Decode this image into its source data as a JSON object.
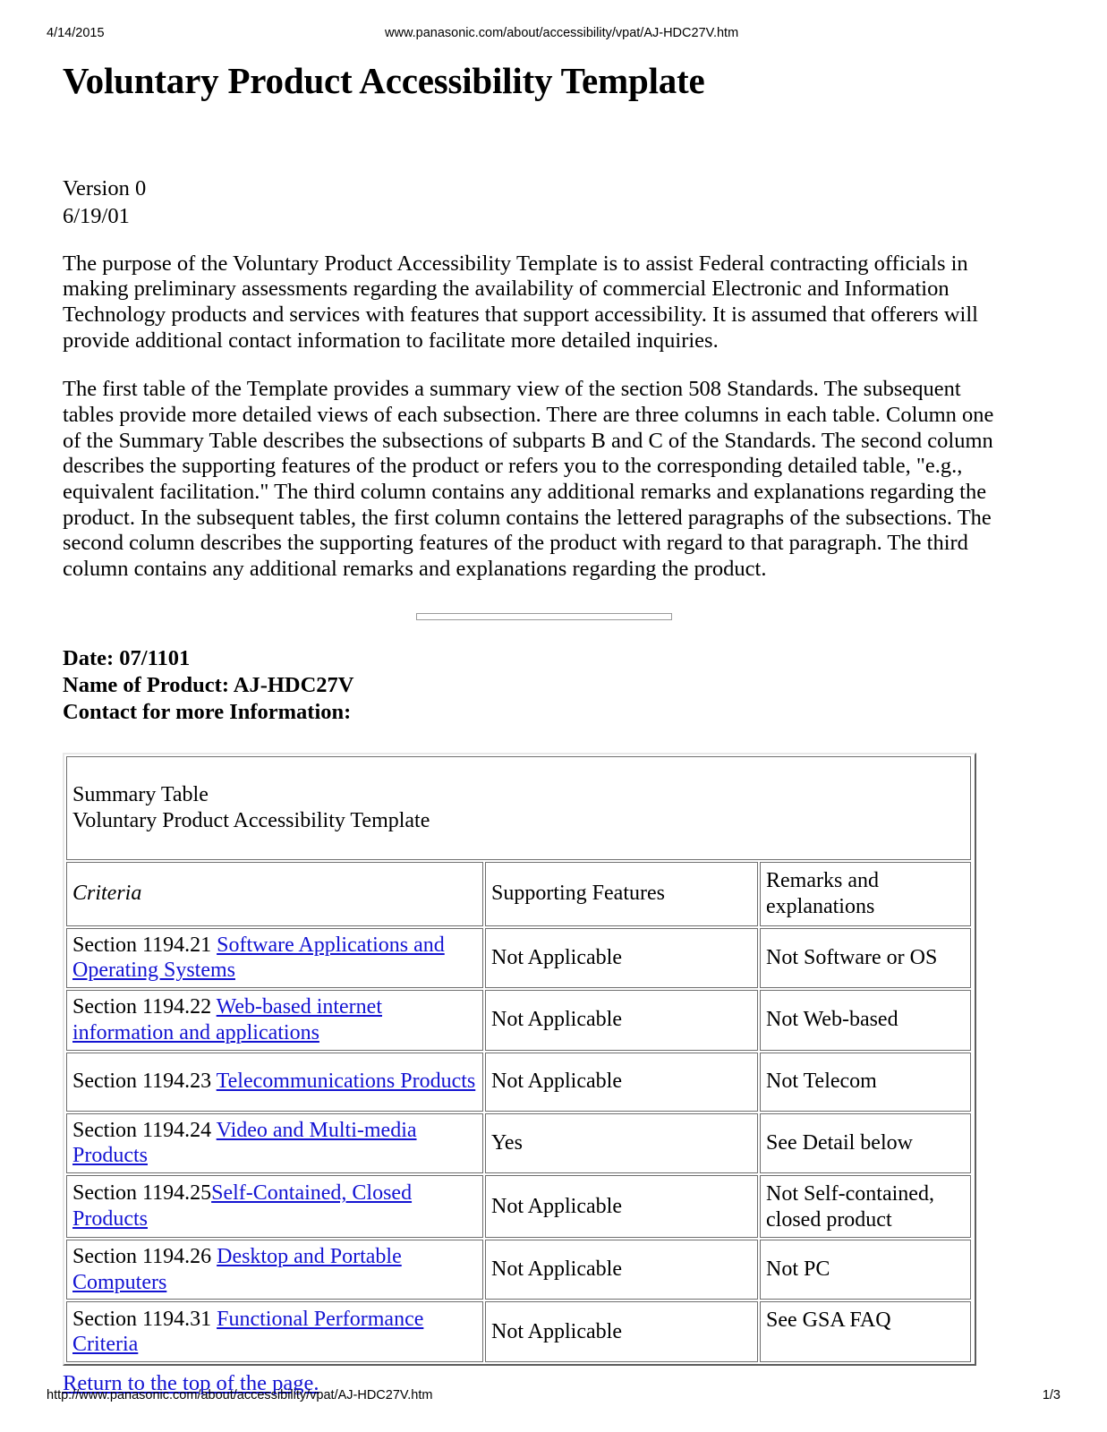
{
  "print_header": {
    "date": "4/14/2015",
    "url": "www.panasonic.com/about/accessibility/vpat/AJ-HDC27V.htm"
  },
  "document": {
    "title": "Voluntary Product Accessibility Template",
    "version_label": "Version 0",
    "version_date": "6/19/01",
    "paragraph_1": "The purpose of the Voluntary Product Accessibility Template is to assist Federal contracting officials in making preliminary assessments regarding the availability of commercial Electronic and Information Technology products and services with features that support accessibility. It is assumed that offerers will provide additional contact information to facilitate more detailed inquiries.",
    "paragraph_2": "The first table of the Template provides a summary view of the section 508 Standards. The subsequent tables provide more detailed views of each subsection. There are three columns in each table. Column one of the Summary Table describes the subsections of subparts B and C of the Standards. The second column describes the supporting features of the product or refers you to the corresponding detailed table, \"e.g., equivalent facilitation.\" The third column contains any additional remarks and explanations regarding the product. In the subsequent tables, the first column contains the lettered paragraphs of the subsections. The second column describes the supporting features of the product with regard to that paragraph. The third column contains any additional remarks and explanations regarding the product.",
    "meta": {
      "date_line": "Date: 07/1101",
      "product_line": "Name of Product: AJ-HDC27V",
      "contact_line": "Contact for more Information:"
    }
  },
  "summary_table": {
    "caption_line_1": "Summary Table",
    "caption_line_2": "Voluntary Product Accessibility Template",
    "headers": {
      "criteria": "Criteria",
      "supporting_features": "Supporting Features",
      "remarks": "Remarks and explanations"
    },
    "rows": [
      {
        "criteria_prefix": "Section 1194.21 ",
        "criteria_link": "Software Applications and Operating Systems",
        "supporting_features": "Not Applicable",
        "remarks": "Not Software or OS"
      },
      {
        "criteria_prefix": "Section 1194.22 ",
        "criteria_link": "Web-based internet information and applications",
        "supporting_features": "Not Applicable",
        "remarks": "Not Web-based"
      },
      {
        "criteria_prefix": "Section 1194.23 ",
        "criteria_link": "Telecommunications Products",
        "supporting_features": "Not Applicable",
        "remarks": "Not Telecom"
      },
      {
        "criteria_prefix": "Section 1194.24 ",
        "criteria_link": "Video and Multi-media Products",
        "supporting_features": "Yes",
        "remarks": "See Detail below"
      },
      {
        "criteria_prefix": "Section 1194.25",
        "criteria_link": "Self-Contained, Closed Products",
        "supporting_features": "Not Applicable",
        "remarks": "Not Self-contained, closed product"
      },
      {
        "criteria_prefix": "Section 1194.26 ",
        "criteria_link": "Desktop and Portable Computers",
        "supporting_features": "Not Applicable",
        "remarks": "Not PC"
      },
      {
        "criteria_prefix": "Section 1194.31 ",
        "criteria_link": "Functional Performance Criteria",
        "supporting_features": "Not Applicable",
        "remarks": "See GSA FAQ"
      }
    ]
  },
  "return_link": "Return to the top of the page.",
  "print_footer": {
    "url": "http://www.panasonic.com/about/accessibility/vpat/AJ-HDC27V.htm",
    "page": "1/3"
  },
  "colors": {
    "link": "#1414d2",
    "text": "#000000",
    "table_border": "#6e6e6e",
    "background": "#ffffff"
  }
}
